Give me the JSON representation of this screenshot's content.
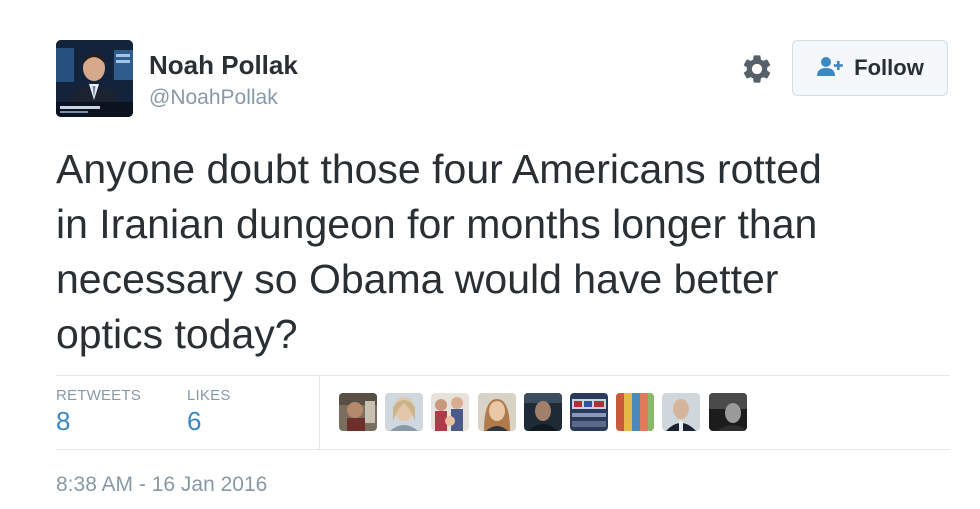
{
  "tweet": {
    "author_name": "Noah Pollak",
    "handle": "@NoahPollak",
    "follow_label": "Follow",
    "text": "Anyone doubt those four Americans rotted\nin Iranian dungeon for months longer than\nnecessary so Obama would have better\noptics today?",
    "timestamp": "8:38 AM - 16 Jan 2016"
  },
  "stats": {
    "retweets_label": "RETWEETS",
    "retweets_value": "8",
    "likes_label": "LIKES",
    "likes_value": "6"
  },
  "icons": {
    "settings": "gear-icon",
    "follow": "add-user-icon"
  },
  "colors": {
    "text": "#292f33",
    "muted": "#8899a6",
    "accent": "#3b88c3",
    "divider": "#e1e8ed"
  }
}
